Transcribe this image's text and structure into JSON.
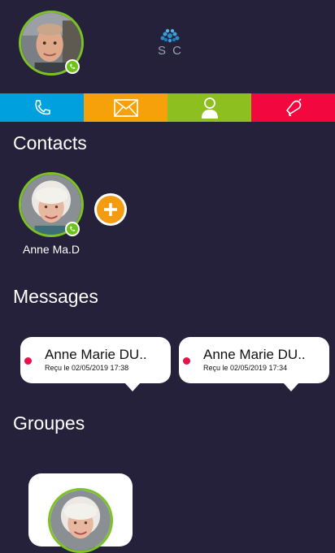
{
  "header": {
    "logo_text": "S C",
    "logo_icon": "tree-logo",
    "profile_status": "phone-icon"
  },
  "tabs": [
    {
      "name": "call",
      "icon": "phone-icon",
      "color": "#00a0df"
    },
    {
      "name": "messages",
      "icon": "mail-icon",
      "color": "#f7a10a"
    },
    {
      "name": "contacts",
      "icon": "user-icon",
      "color": "#8cbf1f"
    },
    {
      "name": "alert",
      "icon": "bell-icon",
      "color": "#f2073f"
    }
  ],
  "contacts": {
    "title": "Contacts",
    "items": [
      {
        "name": "Anne Ma.D"
      }
    ],
    "add_icon": "plus-icon"
  },
  "messages": {
    "title": "Messages",
    "items": [
      {
        "sender": "Anne Marie DU..",
        "date": "Reçu le 02/05/2019 17:38"
      },
      {
        "sender": "Anne Marie DU..",
        "date": "Reçu le 02/05/2019 17:34"
      }
    ]
  },
  "groups": {
    "title": "Groupes"
  },
  "colors": {
    "background": "#25213a",
    "accent_green": "#7cc224",
    "unread_dot": "#e5134a",
    "add_orange": "#f39c12"
  }
}
